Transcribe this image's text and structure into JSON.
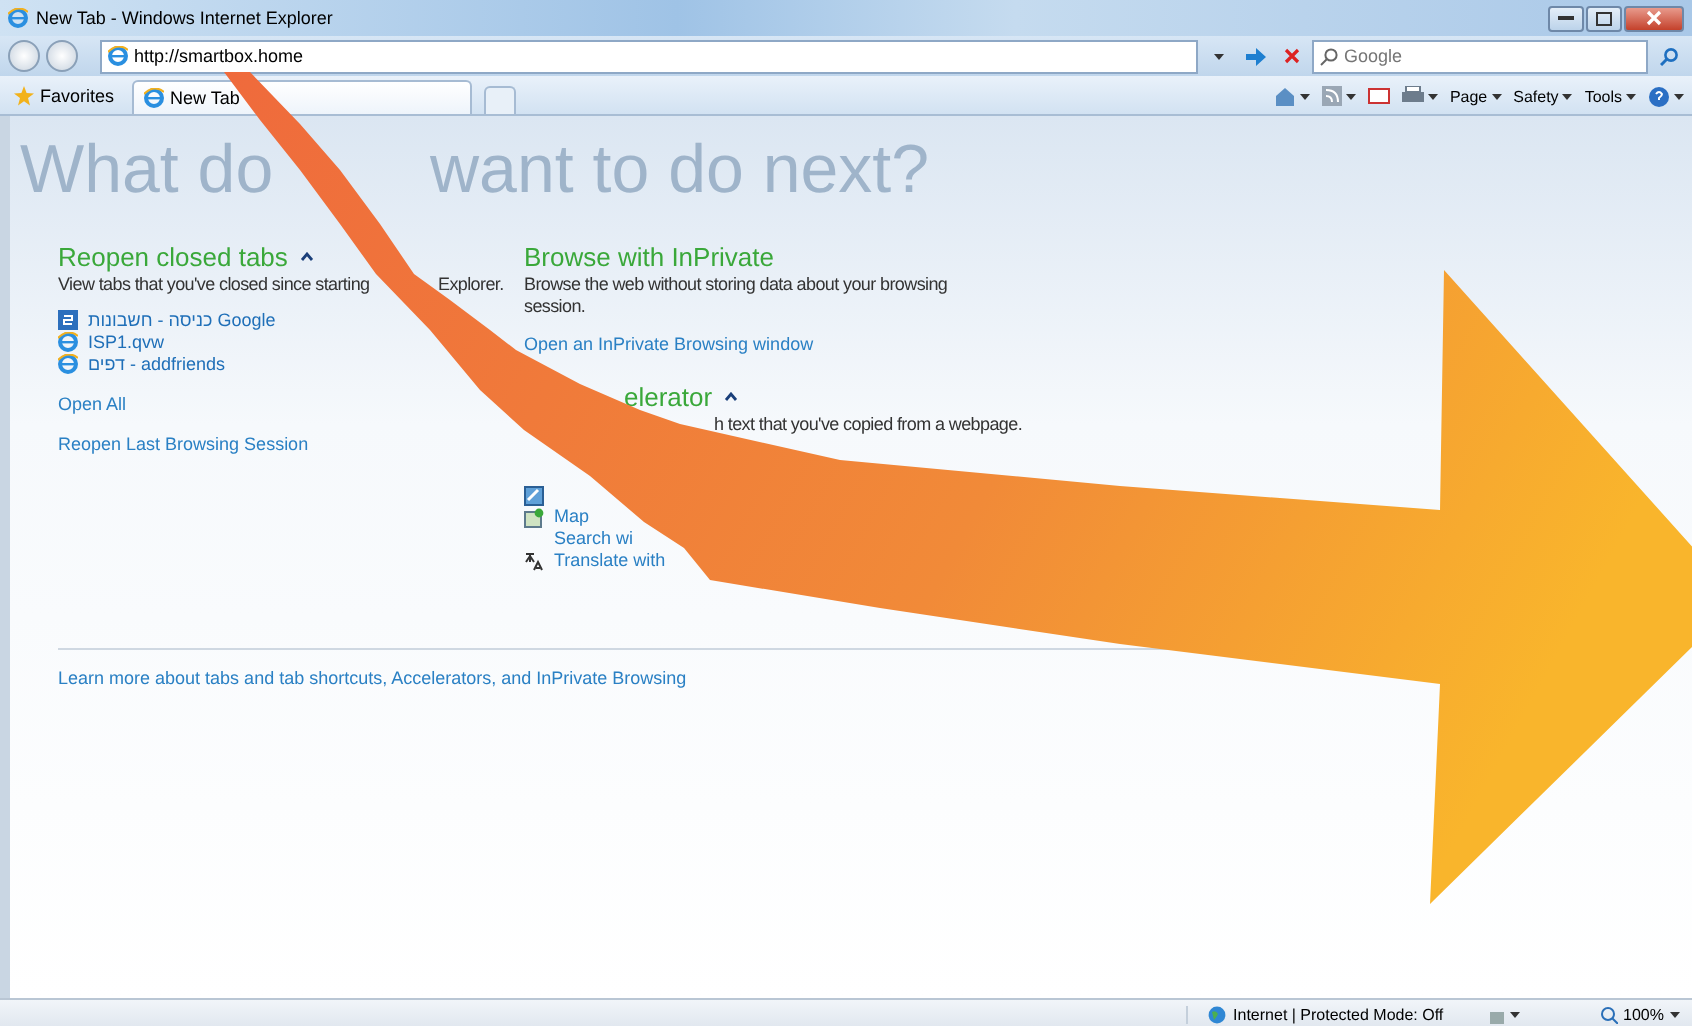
{
  "window": {
    "title": "New Tab - Windows Internet Explorer"
  },
  "address_bar": {
    "value": "http://smartbox.home"
  },
  "search": {
    "placeholder": "Google"
  },
  "favorites": {
    "label": "Favorites"
  },
  "tabs": [
    {
      "label": "New Tab",
      "selected": true
    }
  ],
  "command_bar": [
    {
      "label": "Page"
    },
    {
      "label": "Safety"
    },
    {
      "label": "Tools"
    }
  ],
  "page": {
    "heading_parts": [
      "What do",
      "want to do next?"
    ],
    "reopen": {
      "title": "Reopen closed tabs",
      "expanded": true,
      "description_parts": [
        "View tabs that you've closed since starting",
        "Explorer."
      ],
      "items": [
        {
          "label": "כניסה - חשבונות Google",
          "kind": "google"
        },
        {
          "label": "ISP1.qvw",
          "kind": "ie"
        },
        {
          "label": "דפים - addfriends",
          "kind": "ie"
        }
      ],
      "links": [
        "Open All",
        "Reopen Last Browsing Session"
      ]
    },
    "inprivate": {
      "title": "Browse with InPrivate",
      "description": "Browse the web without storing data about your browsing session.",
      "link": "Open an InPrivate Browsing window"
    },
    "accelerator": {
      "title": "elerator",
      "expanded": true,
      "description": "h text that you've copied from a webpage.",
      "items": [
        {
          "kind": "blog"
        },
        {
          "kind": "map",
          "label": "Map"
        },
        {
          "kind": "none",
          "label": "Search wi"
        },
        {
          "kind": "translate",
          "label": "Translate with"
        }
      ]
    },
    "footer_link": "Learn more about tabs and tab shortcuts, Accelerators, and InPrivate Browsing"
  },
  "status_bar": {
    "zone": "Internet | Protected Mode: Off",
    "zoom": "100%"
  }
}
